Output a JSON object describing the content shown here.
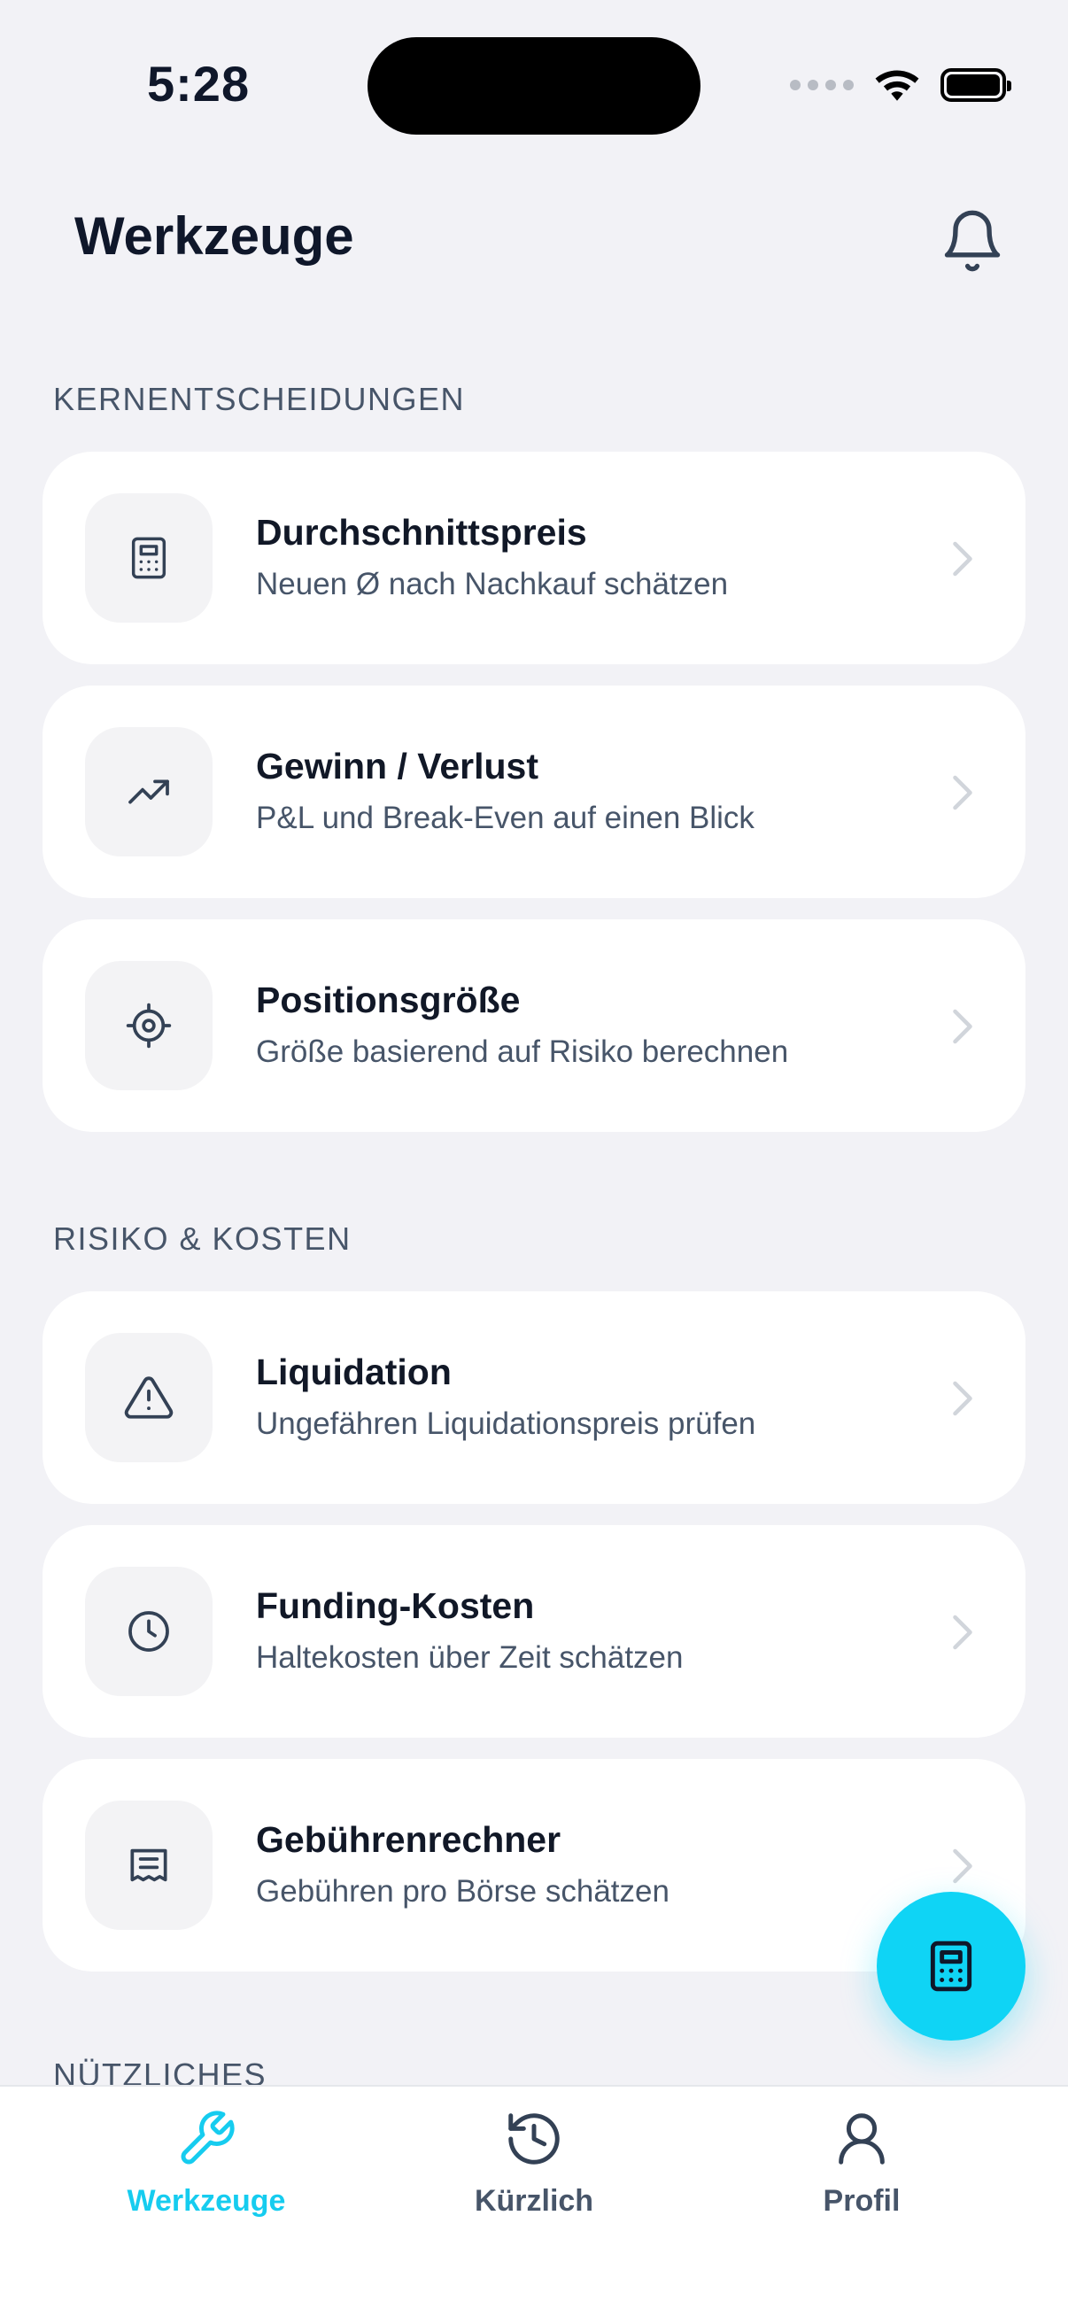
{
  "status": {
    "time": "5:28"
  },
  "header": {
    "title": "Werkzeuge"
  },
  "sections": [
    {
      "label": "KERNENTSCHEIDUNGEN"
    },
    {
      "label": "RISIKO & KOSTEN"
    },
    {
      "label": "NÜTZLICHES"
    }
  ],
  "cards": [
    {
      "title": "Durchschnittspreis",
      "subtitle": "Neuen Ø nach Nachkauf schätzen",
      "icon": "calculator-icon"
    },
    {
      "title": "Gewinn / Verlust",
      "subtitle": "P&L und Break-Even auf einen Blick",
      "icon": "trending-up-icon"
    },
    {
      "title": "Positionsgröße",
      "subtitle": "Größe basierend auf Risiko berechnen",
      "icon": "target-icon"
    },
    {
      "title": "Liquidation",
      "subtitle": "Ungefähren Liquidationspreis prüfen",
      "icon": "warning-icon"
    },
    {
      "title": "Funding-Kosten",
      "subtitle": "Haltekosten über Zeit schätzen",
      "icon": "clock-icon"
    },
    {
      "title": "Gebührenrechner",
      "subtitle": "Gebühren pro Börse schätzen",
      "icon": "receipt-icon"
    }
  ],
  "tabs": [
    {
      "label": "Werkzeuge",
      "icon": "wrench-icon",
      "active": true
    },
    {
      "label": "Kürzlich",
      "icon": "history-icon",
      "active": false
    },
    {
      "label": "Profil",
      "icon": "user-icon",
      "active": false
    }
  ],
  "colors": {
    "accent": "#0fd4f5",
    "background": "#f2f2f6",
    "card": "#ffffff",
    "text": "#0f172a",
    "muted": "#475569"
  }
}
